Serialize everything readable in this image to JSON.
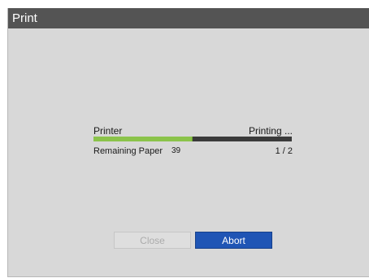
{
  "dialog": {
    "title": "Print",
    "printer_label": "Printer",
    "status_text": "Printing ...",
    "progress": 0.5,
    "progress_color": "#8bc34a",
    "remaining_paper_label": "Remaining Paper",
    "remaining_paper_count": "39",
    "page_counter": "1 / 2",
    "close_button": "Close",
    "abort_button": "Abort"
  }
}
